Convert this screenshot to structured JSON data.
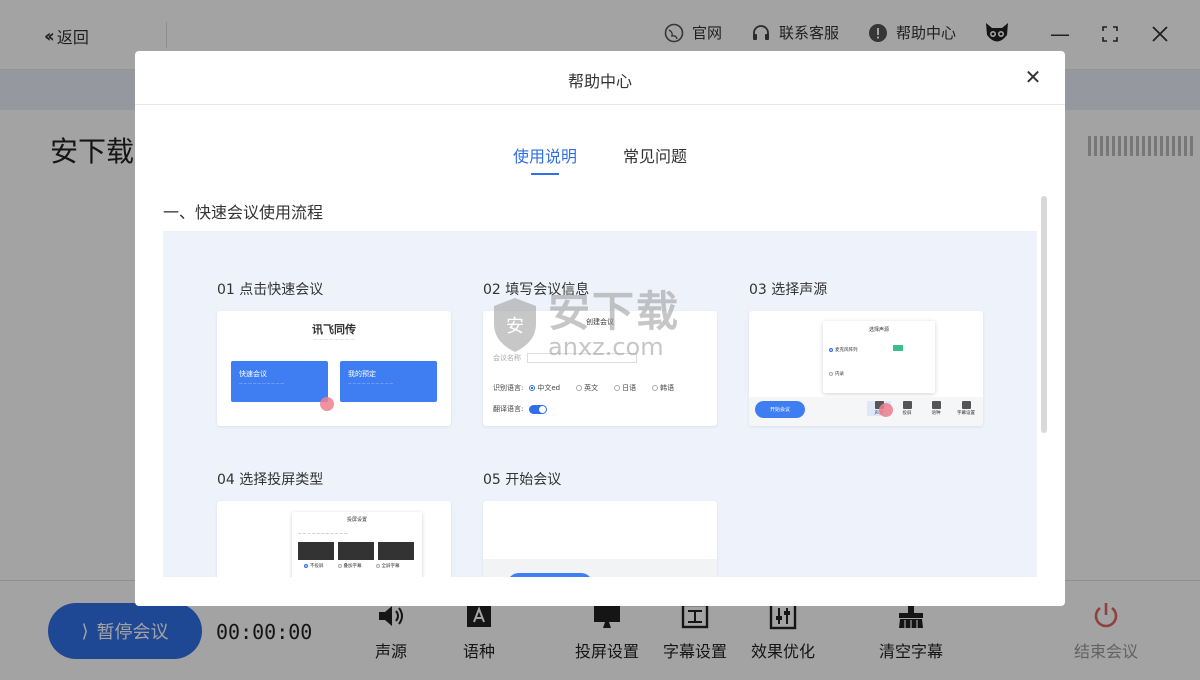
{
  "topbar": {
    "back_label": "返回",
    "website_label": "官网",
    "support_label": "联系客服",
    "help_label": "帮助中心"
  },
  "main": {
    "title": "安下载"
  },
  "bottombar": {
    "pause_label": "暂停会议",
    "timer": "00:00:00",
    "tools": [
      "声源",
      "语种",
      "投屏设置",
      "字幕设置",
      "效果优化",
      "清空字幕"
    ],
    "end_label": "结束会议"
  },
  "modal": {
    "title": "帮助中心",
    "tabs": [
      {
        "label": "使用说明",
        "active": true
      },
      {
        "label": "常见问题",
        "active": false
      }
    ],
    "section_title": "一、快速会议使用流程",
    "steps": [
      {
        "label": "01 点击快速会议"
      },
      {
        "label": "02 填写会议信息"
      },
      {
        "label": "03 选择声源"
      },
      {
        "label": "04 选择投屏类型"
      },
      {
        "label": "05 开始会议"
      }
    ],
    "card1": {
      "title": "讯飞同传",
      "btn1": "快速会议",
      "btn2": "我的预定"
    },
    "card2": {
      "head": "创建会议",
      "row1": "会议名称",
      "lang_label": "识别语言:",
      "langs": [
        "中文ed",
        "英文",
        "日语",
        "韩语"
      ],
      "trans_label": "翻译语言:"
    },
    "card3": {
      "popup_title": "选择声源",
      "opt1": "麦克风阵列",
      "opt2": "内录",
      "start": "开始会议",
      "icons": [
        "声源",
        "投屏",
        "语种",
        "字幕设置"
      ]
    },
    "card4": {
      "dlg_title": "投屏设置",
      "opts": [
        "不投屏",
        "叠加字幕",
        "全屏字幕"
      ]
    }
  },
  "watermark": {
    "cn": "安下载",
    "en": "anxz.com"
  },
  "colors": {
    "accent": "#2f6fe8",
    "panel_bg": "#eef2fa",
    "overlay": "rgba(0,0,0,0.36)"
  }
}
